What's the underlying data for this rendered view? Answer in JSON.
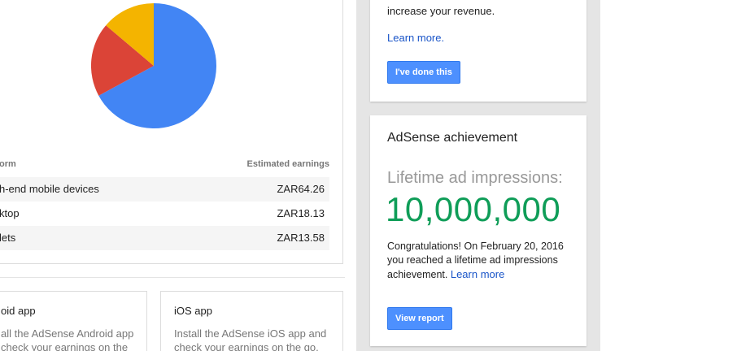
{
  "earnings": {
    "column_platform": "orm",
    "column_earnings": "Estimated earnings",
    "rows": [
      {
        "platform": "h-end mobile devices",
        "earnings": "ZAR64.26"
      },
      {
        "platform": "ktop",
        "earnings": "ZAR18.13"
      },
      {
        "platform": "lets",
        "earnings": "ZAR13.58"
      }
    ],
    "pie_colors": [
      "#4285f4",
      "#db4437",
      "#f4b400"
    ]
  },
  "apps": {
    "android": {
      "title": "oid app",
      "desc_line1": "all the AdSense Android app",
      "desc_line2": "check your earnings on the"
    },
    "ios": {
      "title": "iOS app",
      "desc_line1": "Install the AdSense iOS app and",
      "desc_line2": "check your earnings on the go."
    }
  },
  "tip_card": {
    "text": "increase your revenue.",
    "link": "Learn more.",
    "button": "I've done this"
  },
  "achievement": {
    "title": "AdSense achievement",
    "label": "Lifetime ad impressions:",
    "value": "10,000,000",
    "desc": "Congratulations! On February 20, 2016 you reached a lifetime ad impressions achievement.",
    "link": "Learn more",
    "button": "View report"
  },
  "colors": {
    "accent": "#4d90fe",
    "achievement_green": "#0f9d58",
    "link": "#1a55c8"
  }
}
